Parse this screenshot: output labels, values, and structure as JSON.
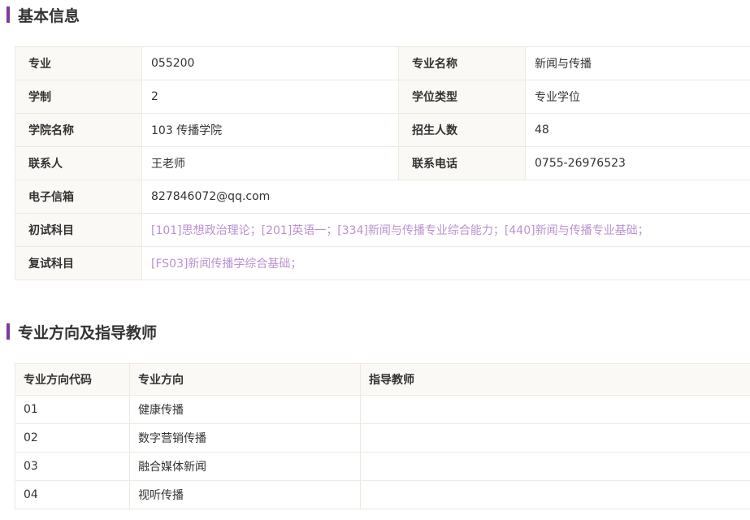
{
  "sections": {
    "basic": "基本信息",
    "directions": "专业方向及指导教师"
  },
  "basic": {
    "major_label": "专业",
    "major_value": "055200",
    "major_name_label": "专业名称",
    "major_name_value": "新闻与传播",
    "duration_label": "学制",
    "duration_value": "2",
    "degree_type_label": "学位类型",
    "degree_type_value": "专业学位",
    "college_label": "学院名称",
    "college_value": "103 传播学院",
    "enrollment_label": "招生人数",
    "enrollment_value": "48",
    "contact_label": "联系人",
    "contact_value": "王老师",
    "phone_label": "联系电话",
    "phone_value": "0755-26976523",
    "email_label": "电子信箱",
    "email_value": "827846072@qq.com",
    "prelim_label": "初试科目",
    "prelim_value": "[101]思想政治理论；[201]英语一；[334]新闻与传播专业综合能力；[440]新闻与传播专业基础；",
    "retest_label": "复试科目",
    "retest_value": "[FS03]新闻传播学综合基础；"
  },
  "directions": {
    "headers": [
      "专业方向代码",
      "专业方向",
      "指导教师"
    ],
    "rows": [
      {
        "code": "01",
        "name": "健康传播",
        "teacher": ""
      },
      {
        "code": "02",
        "name": "数字营销传播",
        "teacher": ""
      },
      {
        "code": "03",
        "name": "融合媒体新闻",
        "teacher": ""
      },
      {
        "code": "04",
        "name": "视听传播",
        "teacher": ""
      }
    ]
  },
  "colors": {
    "accent_bar": "#7b3a9c",
    "link_text": "#b992cf",
    "label_bg": "#fbf9f6",
    "border": "#efe8df"
  }
}
